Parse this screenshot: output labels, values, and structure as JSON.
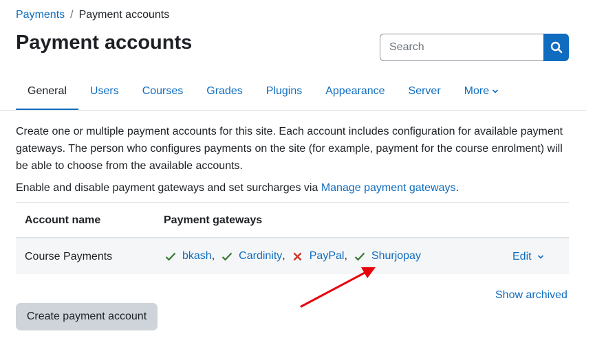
{
  "breadcrumb": {
    "parent": "Payments",
    "separator": "/",
    "current": "Payment accounts"
  },
  "page_title": "Payment accounts",
  "search": {
    "placeholder": "Search"
  },
  "tabs": [
    {
      "label": "General",
      "active": true
    },
    {
      "label": "Users"
    },
    {
      "label": "Courses"
    },
    {
      "label": "Grades"
    },
    {
      "label": "Plugins"
    },
    {
      "label": "Appearance"
    },
    {
      "label": "Server"
    },
    {
      "label": "More"
    }
  ],
  "intro_text": "Create one or multiple payment accounts for this site. Each account includes configuration for available payment gateways. The person who configures payments on the site (for example, payment for the course enrolment) will be able to choose from the available accounts.",
  "gateways_note": {
    "prefix": "Enable and disable payment gateways and set surcharges via ",
    "link": "Manage payment gateways",
    "suffix": "."
  },
  "table": {
    "headers": {
      "name": "Account name",
      "gateways": "Payment gateways"
    },
    "rows": [
      {
        "name": "Course Payments",
        "gateways": [
          {
            "name": "bkash",
            "status": "enabled",
            "comma": ","
          },
          {
            "name": "Cardinity",
            "status": "enabled",
            "comma": ","
          },
          {
            "name": "PayPal",
            "status": "disabled",
            "comma": ","
          },
          {
            "name": "Shurjopay",
            "status": "enabled",
            "comma": ""
          }
        ],
        "edit_label": "Edit"
      }
    ]
  },
  "show_archived": "Show archived",
  "create_button": "Create payment account",
  "colors": {
    "link": "#0f6cbf",
    "enabled": "#357a32",
    "disabled": "#ca3120",
    "annotation_arrow": "#e8000b"
  }
}
